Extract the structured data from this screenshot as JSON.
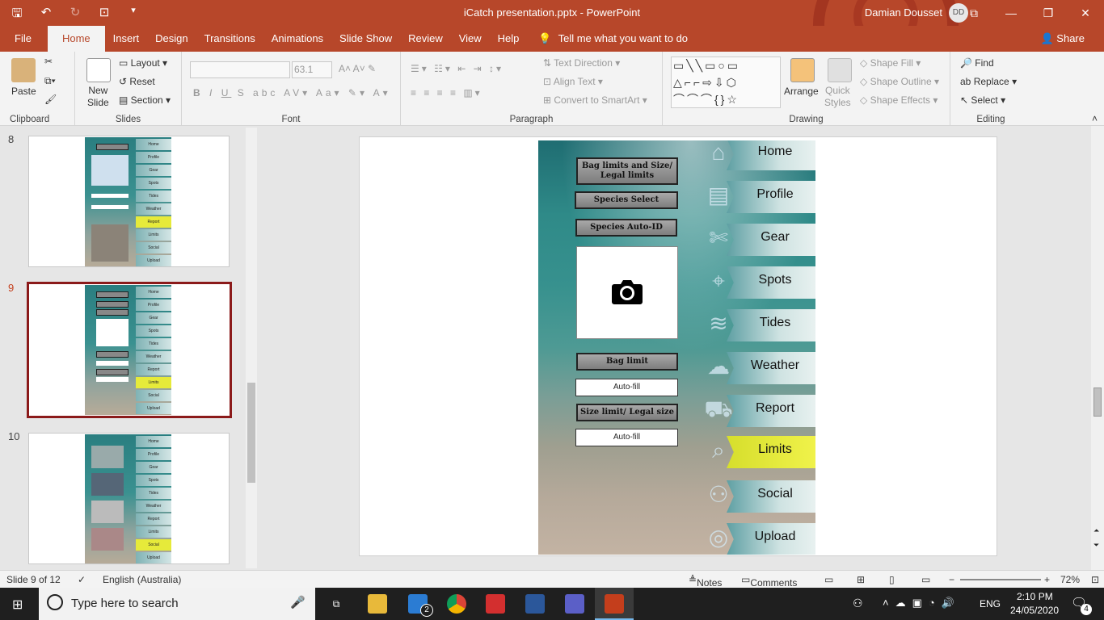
{
  "window": {
    "title": "iCatch presentation.pptx  -  PowerPoint",
    "user": "Damian Dousset",
    "initials": "DD"
  },
  "tabs": [
    "File",
    "Home",
    "Insert",
    "Design",
    "Transitions",
    "Animations",
    "Slide Show",
    "Review",
    "View",
    "Help"
  ],
  "tell_me": "Tell me what you want to do",
  "share": "Share",
  "ribbon": {
    "clipboard": {
      "label": "Clipboard",
      "paste": "Paste"
    },
    "slides": {
      "label": "Slides",
      "new_slide": "New\nSlide",
      "layout": "Layout",
      "reset": "Reset",
      "section": "Section"
    },
    "font": {
      "label": "Font",
      "size": "63.1"
    },
    "paragraph": {
      "label": "Paragraph",
      "text_direction": "Text Direction",
      "align_text": "Align Text",
      "convert": "Convert to SmartArt"
    },
    "drawing": {
      "label": "Drawing",
      "arrange": "Arrange",
      "quick_styles": "Quick\nStyles",
      "shape_fill": "Shape Fill",
      "shape_outline": "Shape Outline",
      "shape_effects": "Shape Effects"
    },
    "editing": {
      "label": "Editing",
      "find": "Find",
      "replace": "Replace",
      "select": "Select"
    }
  },
  "thumbnails": [
    {
      "num": "8"
    },
    {
      "num": "9"
    },
    {
      "num": "10"
    }
  ],
  "thumb_nav": [
    "Home",
    "Profile",
    "Gear",
    "Spots",
    "Tides",
    "Weather",
    "Report",
    "Limits",
    "Social",
    "Upload"
  ],
  "slide": {
    "buttons": [
      "Bag limits and Size/ Legal limits",
      "Species Select",
      "Species Auto-ID",
      "Bag limit",
      "Size limit/ Legal size"
    ],
    "autofill": "Auto-fill",
    "nav": [
      {
        "label": "Home",
        "icon": "home-icon",
        "highlight": false
      },
      {
        "label": "Profile",
        "icon": "profile-card-icon",
        "highlight": false
      },
      {
        "label": "Gear",
        "icon": "knife-icon",
        "highlight": false
      },
      {
        "label": "Spots",
        "icon": "map-pin-icon",
        "highlight": false
      },
      {
        "label": "Tides",
        "icon": "wave-icon",
        "highlight": false
      },
      {
        "label": "Weather",
        "icon": "weather-icon",
        "highlight": false
      },
      {
        "label": "Report",
        "icon": "truck-icon",
        "highlight": false
      },
      {
        "label": "Limits",
        "icon": "search-chart-icon",
        "highlight": true
      },
      {
        "label": "Social",
        "icon": "people-icon",
        "highlight": false
      },
      {
        "label": "Upload",
        "icon": "camera-icon",
        "highlight": false
      }
    ]
  },
  "status": {
    "slide": "Slide 9 of 12",
    "language": "English (Australia)",
    "notes": "Notes",
    "comments": "Comments",
    "zoom": "72%"
  },
  "taskbar": {
    "search_placeholder": "Type here to search",
    "time": "2:10 PM",
    "date": "24/05/2020",
    "lang": "ENG",
    "badge": "4",
    "mail_badge": "2"
  }
}
